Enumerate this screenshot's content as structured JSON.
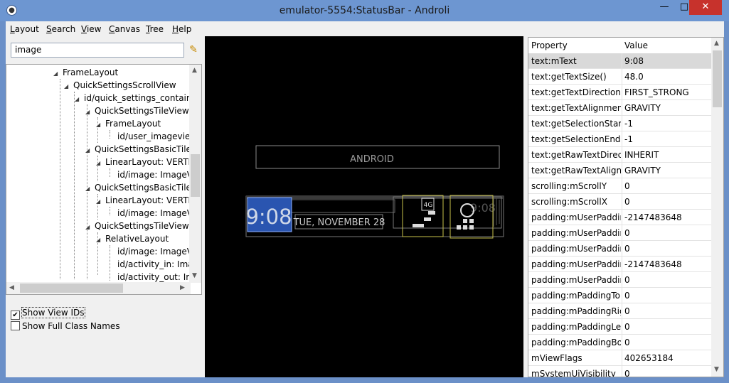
{
  "window": {
    "title": "emulator-5554:StatusBar - Androli",
    "minimize": "—",
    "maximize": "□",
    "close": "✕"
  },
  "menu": [
    "Layout",
    "Search",
    "View",
    "Canvas",
    "Tree",
    "Help"
  ],
  "search": {
    "value": "image"
  },
  "tree": {
    "items": [
      "FrameLayout",
      "QuickSettingsScrollView",
      "id/quick_settings_container",
      "QuickSettingsTileView",
      "FrameLayout",
      "id/user_imageview:",
      "QuickSettingsBasicTile",
      "LinearLayout: VERTICA",
      "id/image: ImageVie",
      "QuickSettingsBasicTile",
      "LinearLayout: VERTICA",
      "id/image: ImageVie",
      "QuickSettingsTileView",
      "RelativeLayout",
      "id/image: ImageVie",
      "id/activity_in: Imag",
      "id/activity_out: Ima"
    ]
  },
  "options": {
    "show_view_ids": "Show View IDs",
    "show_full_class_names": "Show Full Class Names"
  },
  "canvas": {
    "android_label": "ANDROID",
    "clock": "9:08",
    "date": "TUE, NOVEMBER 28",
    "network": "4G",
    "clock_small": "9:08"
  },
  "properties": {
    "header_property": "Property",
    "header_value": "Value",
    "rows": [
      {
        "k": "text:mText",
        "v": "9:08"
      },
      {
        "k": "text:getTextSize()",
        "v": "48.0"
      },
      {
        "k": "text:getTextDirection()",
        "v": "FIRST_STRONG"
      },
      {
        "k": "text:getTextAlignment()",
        "v": "GRAVITY"
      },
      {
        "k": "text:getSelectionStart()",
        "v": "-1"
      },
      {
        "k": "text:getSelectionEnd()",
        "v": "-1"
      },
      {
        "k": "text:getRawTextDirectio",
        "v": "INHERIT"
      },
      {
        "k": "text:getRawTextAlignme",
        "v": "GRAVITY"
      },
      {
        "k": "scrolling:mScrollY",
        "v": "0"
      },
      {
        "k": "scrolling:mScrollX",
        "v": "0"
      },
      {
        "k": "padding:mUserPadding",
        "v": "-2147483648"
      },
      {
        "k": "padding:mUserPadding",
        "v": "0"
      },
      {
        "k": "padding:mUserPadding",
        "v": "0"
      },
      {
        "k": "padding:mUserPadding",
        "v": "-2147483648"
      },
      {
        "k": "padding:mUserPadding",
        "v": "0"
      },
      {
        "k": "padding:mPaddingTop",
        "v": "0"
      },
      {
        "k": "padding:mPaddingRigh",
        "v": "0"
      },
      {
        "k": "padding:mPaddingLeft",
        "v": "0"
      },
      {
        "k": "padding:mPaddingBott",
        "v": "0"
      },
      {
        "k": "mViewFlags",
        "v": "402653184"
      },
      {
        "k": "mSystemUiVisibility",
        "v": "0"
      }
    ]
  }
}
